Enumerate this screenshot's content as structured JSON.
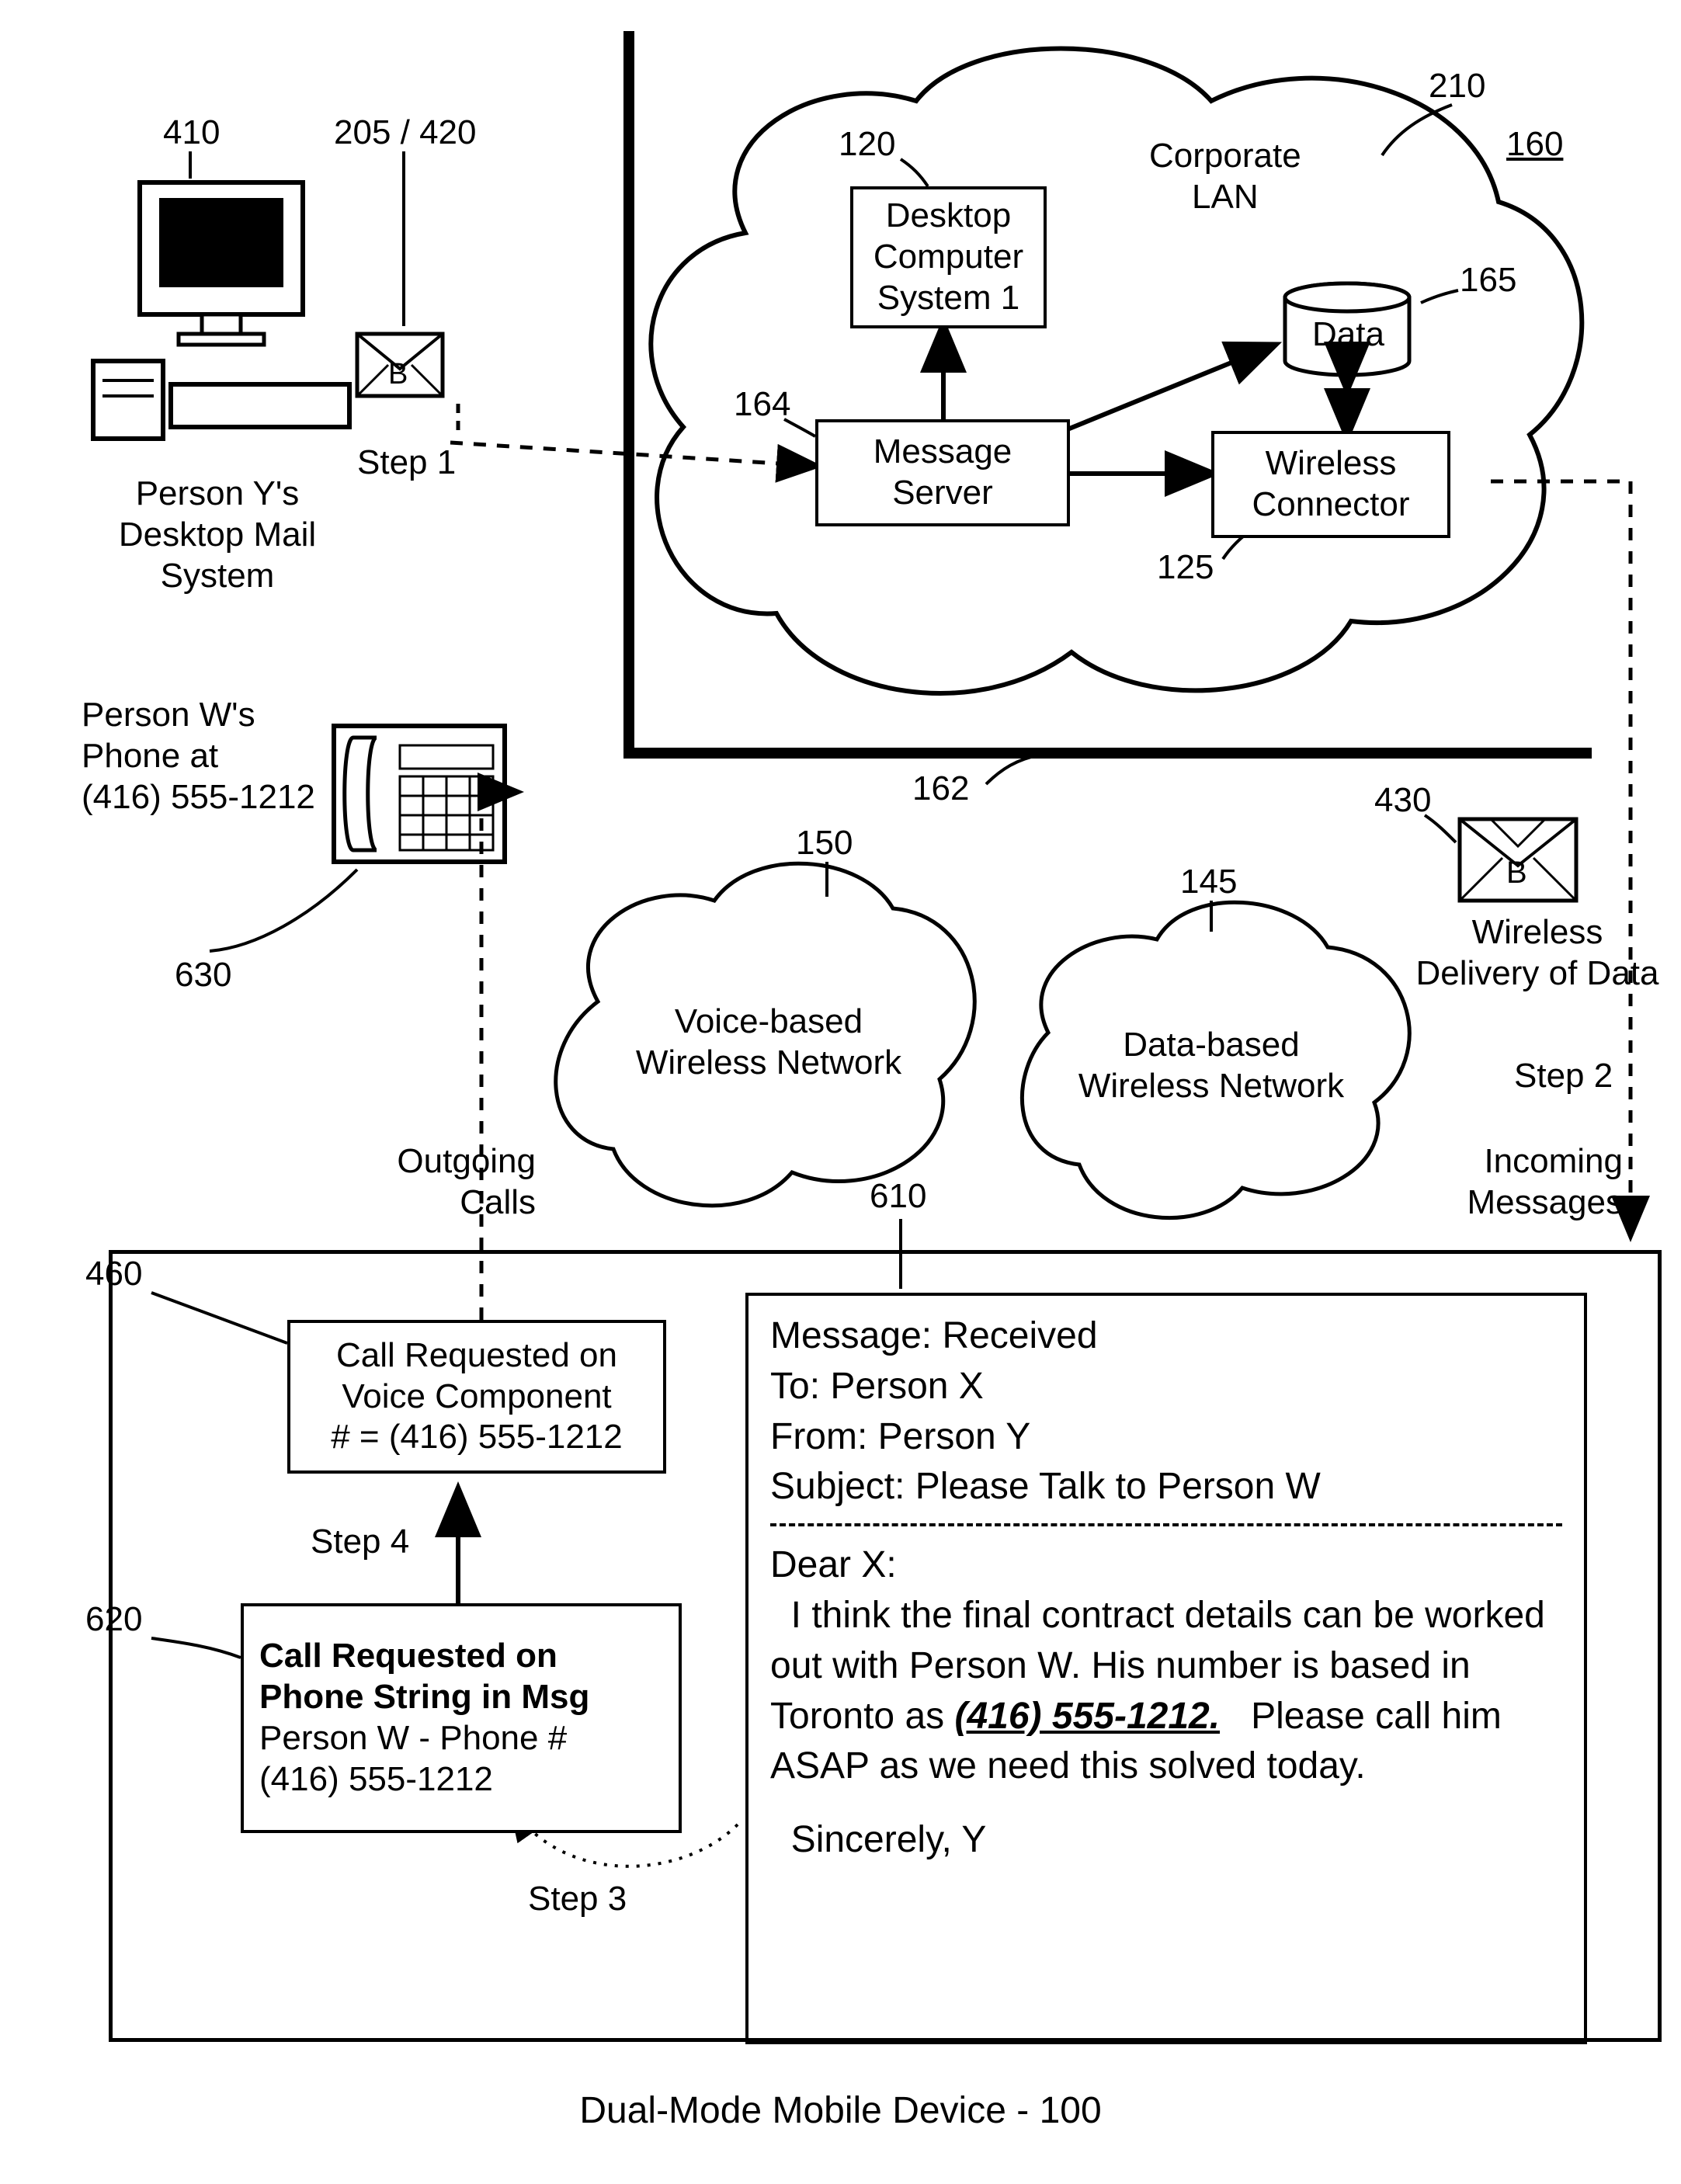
{
  "labels": {
    "n160": "160",
    "n210": "210",
    "n120": "120",
    "n165": "165",
    "n164": "164",
    "n125": "125",
    "n162": "162",
    "n410": "410",
    "n205_420": "205 / 420",
    "n150": "150",
    "n145": "145",
    "n430": "430",
    "n460": "460",
    "n610": "610",
    "n620": "620",
    "n630": "630"
  },
  "corporateLan": "Corporate\nLAN",
  "desktopComputer": "Desktop\nComputer\nSystem 1",
  "data": "Data",
  "messageServer": "Message\nServer",
  "wirelessConnector": "Wireless\nConnector",
  "personY": "Person Y's\nDesktop Mail\nSystem",
  "personW": {
    "label": "Person W's\nPhone at\n(416) 555-1212",
    "phone": "(416) 555-1212"
  },
  "voiceNetwork": "Voice-based\nWireless Network",
  "dataNetwork": "Data-based\nWireless Network",
  "wirelessDelivery": "Wireless\nDelivery of Data",
  "outgoingCalls": "Outgoing\nCalls",
  "incomingMessages": "Incoming\nMessages",
  "steps": {
    "s1": "Step 1",
    "s2": "Step 2",
    "s3": "Step 3",
    "s4": "Step 4"
  },
  "box460": "Call Requested on\nVoice Component\n# = (416) 555-1212",
  "box620": {
    "title": "Call Requested on\nPhone String in Msg",
    "line1": "Person W - Phone #",
    "line2": "(416) 555-1212"
  },
  "msg610": {
    "line1": "Message: Received",
    "to": "To: Person X",
    "from": "From: Person Y",
    "subject": "Subject: Please Talk to Person W",
    "body1": "Dear X:",
    "body2": "  I think the final contract details can be worked out with Person W. His number is based in Toronto as",
    "phoneBold": "(416) 555-1212.",
    "body3": "  Please call him ASAP as we need this solved today.",
    "body4": "  Sincerely, Y"
  },
  "envelopeB": "B",
  "footer": "Dual-Mode Mobile Device - 100"
}
